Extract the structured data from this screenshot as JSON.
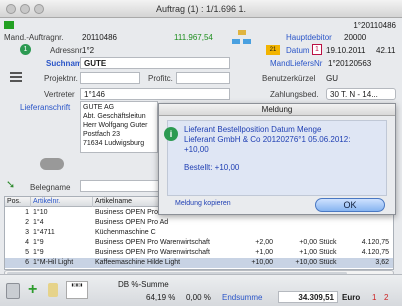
{
  "window": {
    "title": "Auftrag (1) : 1/1.696 1."
  },
  "header": {
    "id_text": "1°20110486",
    "mand_label": "Mand.-Auftragnr.",
    "mand_value": "20110486",
    "amount": "111.967,54",
    "hauptdebitor_label": "Hauptdebitor",
    "hauptdebitor_value": "20000",
    "adressnr_label": "Adressnr.",
    "adressnr_value": "1°2",
    "datum_label": "Datum",
    "datum_value": "19.10.2011",
    "datum_extra": "42.11",
    "suchname_label": "Suchname",
    "suchname_value": "GUTE",
    "mandlieferant_label": "MandLiefersNr",
    "mandlieferant_value": "1°20120563",
    "projekt_label": "Projektnr.",
    "projekt_value": "",
    "profitc_label": "Profitc.",
    "benutzer_label": "Benutzerkürzel",
    "benutzer_value": "GU",
    "vertreter_label": "Vertreter",
    "vertreter_value": "1°146",
    "zahlung_label": "Zahlungsbed.",
    "zahlung_value": "30 T. N - 14...",
    "lieferanschrift_label": "Lieferanschrift",
    "address_lines": [
      "GUTE AG",
      "Abt. Geschäftsleitun",
      "Herr Wolfgang Guter",
      "Postfach 23",
      "71634 Ludwigsburg"
    ],
    "belegname_label": "Belegname",
    "belegname_value": ""
  },
  "dialog": {
    "title": "Meldung",
    "line1": "Lieferant Bestellposition Datum Menge",
    "line2": "Lieferant GmbH & Co  20120276°1 05.06.2012:",
    "line3": "+10,00",
    "line4": "Bestellt: +10,00",
    "copy_label": "Meldung kopieren",
    "ok_label": "OK"
  },
  "table": {
    "columns": [
      "Pos.",
      "Artikelnr.",
      "Artikelname"
    ],
    "rows": [
      {
        "pos": "1",
        "nr": "1°10",
        "name": "Business OPEN Pro",
        "m1": "",
        "m2": "",
        "unit": "",
        "price": ""
      },
      {
        "pos": "2",
        "nr": "1°4",
        "name": "Business OPEN Pro Ad",
        "m1": "",
        "m2": "",
        "unit": "",
        "price": ""
      },
      {
        "pos": "3",
        "nr": "1°4711",
        "name": "Küchenmaschine C",
        "m1": "",
        "m2": "",
        "unit": "",
        "price": ""
      },
      {
        "pos": "4",
        "nr": "1°9",
        "name": "Business OPEN Pro Warenwirtschaft",
        "m1": "+2,00",
        "m2": "+0,00",
        "unit": "Stück",
        "price": "4.120,75"
      },
      {
        "pos": "5",
        "nr": "1°9",
        "name": "Business OPEN Pro Warenwirtschaft",
        "m1": "+1,00",
        "m2": "+1,00",
        "unit": "Stück",
        "price": "4.120,75"
      },
      {
        "pos": "6",
        "nr": "1°M-Hil Light",
        "name": "Kaffeemaschine Hilde Light",
        "m1": "+10,00",
        "m2": "+10,00",
        "unit": "Stück",
        "price": "3,62"
      }
    ]
  },
  "footer": {
    "db_label": "DB %-Summe",
    "db_value": "64,19 %",
    "pct_value": "0,00 %",
    "endsumme_label": "Endsumme",
    "endsumme_value": "34.309,51",
    "currency": "Euro",
    "page1": "1",
    "page2": "2"
  },
  "colors": {
    "accent": "#2a55c8",
    "amount": "#1e8e1e",
    "ok": "#87b4f0"
  }
}
